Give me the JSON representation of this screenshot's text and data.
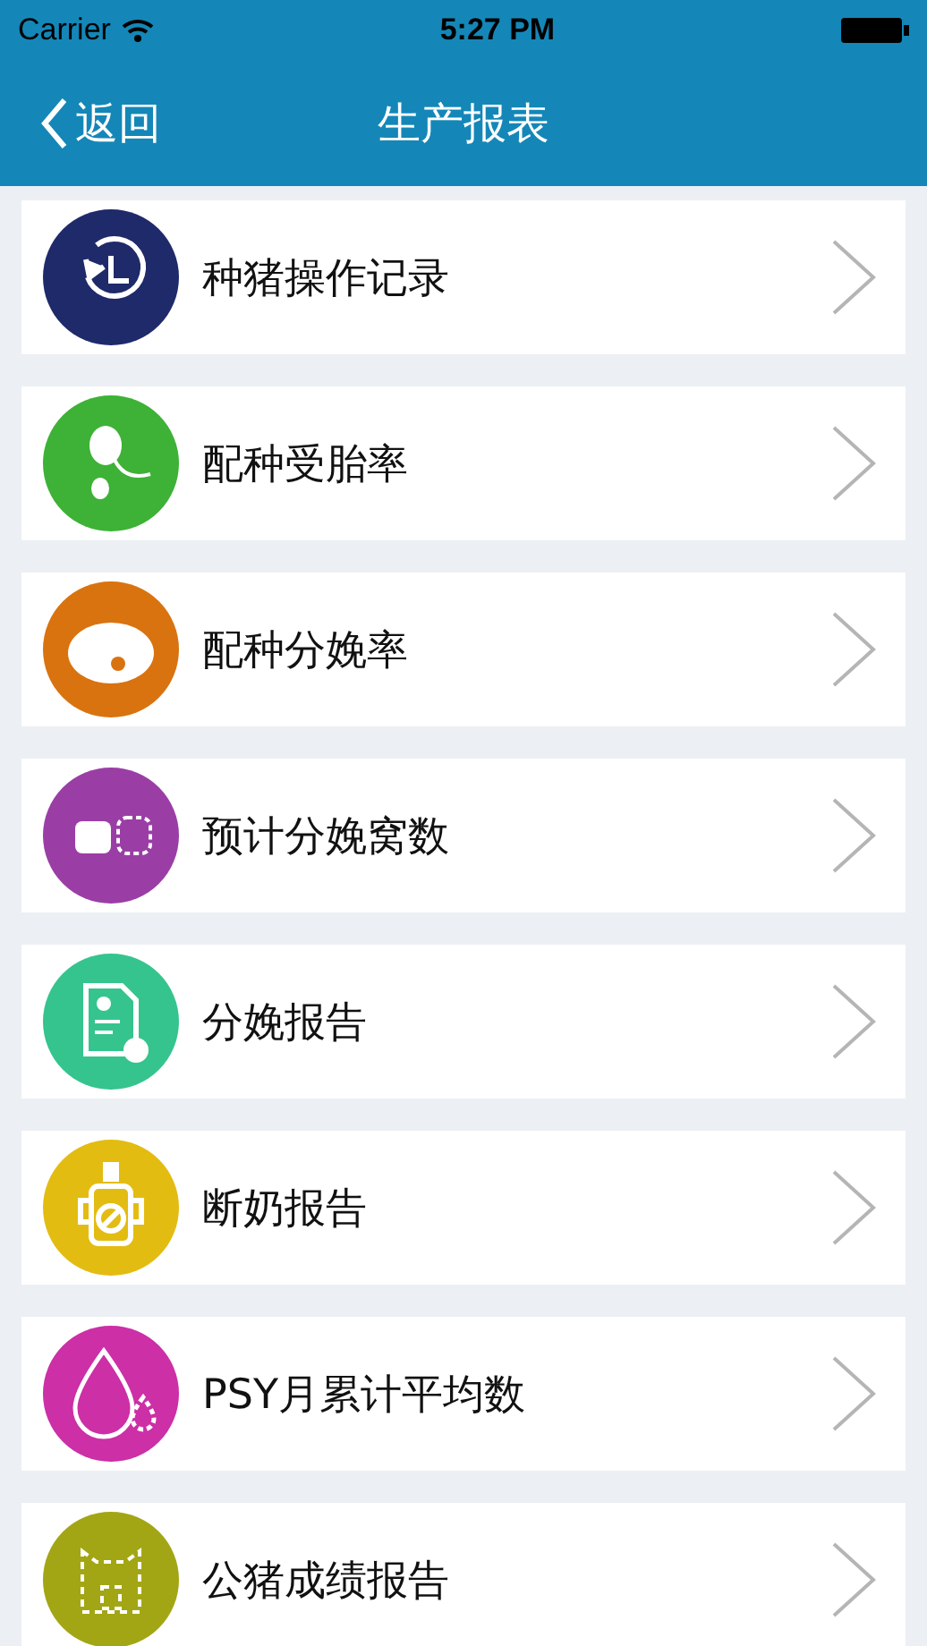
{
  "status_bar": {
    "carrier": "Carrier",
    "time": "5:27 PM"
  },
  "nav": {
    "back": "返回",
    "title": "生产报表"
  },
  "items": [
    {
      "label": "种猪操作记录",
      "kind": "clock",
      "color": "#1f2a6b"
    },
    {
      "label": "配种受胎率",
      "kind": "sperm",
      "color": "#3db236"
    },
    {
      "label": "配种分娩率",
      "kind": "pig",
      "color": "#d9730f"
    },
    {
      "label": "预计分娩窝数",
      "kind": "pigs",
      "color": "#9a3ea6"
    },
    {
      "label": "分娩报告",
      "kind": "report",
      "color": "#35c48e"
    },
    {
      "label": "断奶报告",
      "kind": "bottle",
      "color": "#e3bc12"
    },
    {
      "label": "PSY月累计平均数",
      "kind": "drop",
      "color": "#cc2fa6"
    },
    {
      "label": "公猪成绩报告",
      "kind": "boar",
      "color": "#a3a614"
    }
  ]
}
